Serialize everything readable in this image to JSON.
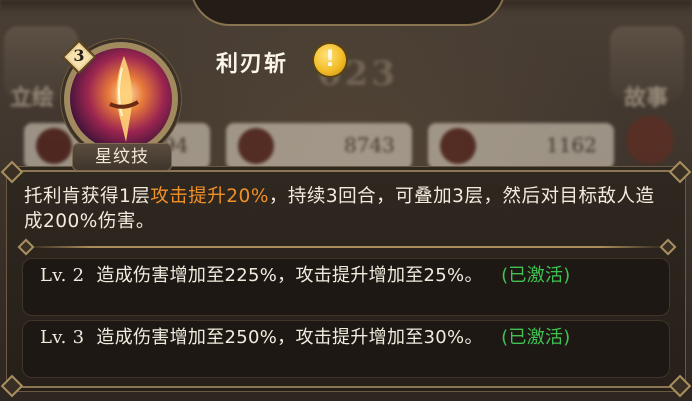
{
  "background": {
    "left_icon_label": "立绘",
    "right_icon_label": "故事",
    "number_text": "023",
    "stats": [
      {
        "icon": "heart-icon",
        "value": "294"
      },
      {
        "icon": "sword-icon",
        "value": "8743"
      },
      {
        "icon": "shield-icon",
        "value": "1162"
      }
    ]
  },
  "skill": {
    "level": "3",
    "name": "利刃斩",
    "type_label": "星纹技",
    "description_parts": {
      "before": "托利肯获得1层",
      "highlight": "攻击提升20%",
      "after": "，持续3回合，可叠加3层，然后对目标敌人造成200%伤害。"
    },
    "levels": [
      {
        "label": "Lv. 2",
        "text": "造成伤害增加至225%，攻击提升增加至25%。",
        "status": "(已激活)"
      },
      {
        "label": "Lv. 3",
        "text": "造成伤害增加至250%，攻击提升增加至30%。",
        "status": "(已激活)"
      }
    ]
  },
  "colors": {
    "highlight": "#f29028",
    "activated": "#3fc252",
    "panel_bg": "#2b241d",
    "frame_gold": "#a8905f"
  }
}
